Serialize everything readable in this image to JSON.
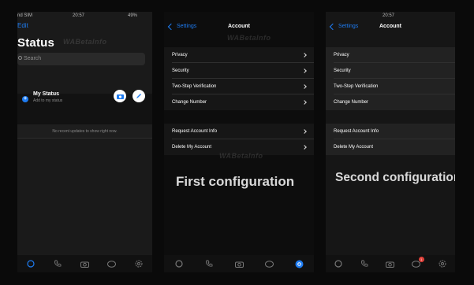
{
  "colors": {
    "accent": "#1e7cf2",
    "badge": "#e0413a"
  },
  "status_screen": {
    "statusbar": {
      "carrier": "nd SIM",
      "time": "20:57",
      "battery": "49%"
    },
    "edit_label": "Edit",
    "title": "Status",
    "search_placeholder": "Search",
    "my_status": {
      "name": "My Status",
      "subtitle": "Add to my status",
      "avatar_plus": "+"
    },
    "empty_message": "No recent updates to show right now.",
    "watermark": "WABetaInfo",
    "tabs": [
      "status-icon",
      "calls-icon",
      "camera-icon",
      "chats-icon",
      "settings-icon"
    ]
  },
  "account_first": {
    "back_label": "Settings",
    "title": "Account",
    "watermark": "WABetaInfo",
    "group1": [
      "Privacy",
      "Security",
      "Two-Step Verification",
      "Change Number"
    ],
    "group2": [
      "Request Account Info",
      "Delete My Account"
    ],
    "caption": "First configuration",
    "tabs": [
      "status-icon",
      "calls-icon",
      "camera-icon",
      "chats-icon",
      "settings-icon"
    ]
  },
  "account_second": {
    "statusbar": {
      "time": "20:57"
    },
    "back_label": "Settings",
    "title": "Account",
    "group1": [
      "Privacy",
      "Security",
      "Two-Step Verification",
      "Change Number"
    ],
    "group2": [
      "Request Account Info",
      "Delete My Account"
    ],
    "caption": "Second configuration",
    "chats_badge": "1",
    "tabs": [
      "status-icon",
      "calls-icon",
      "camera-icon",
      "chats-icon",
      "settings-icon"
    ]
  }
}
